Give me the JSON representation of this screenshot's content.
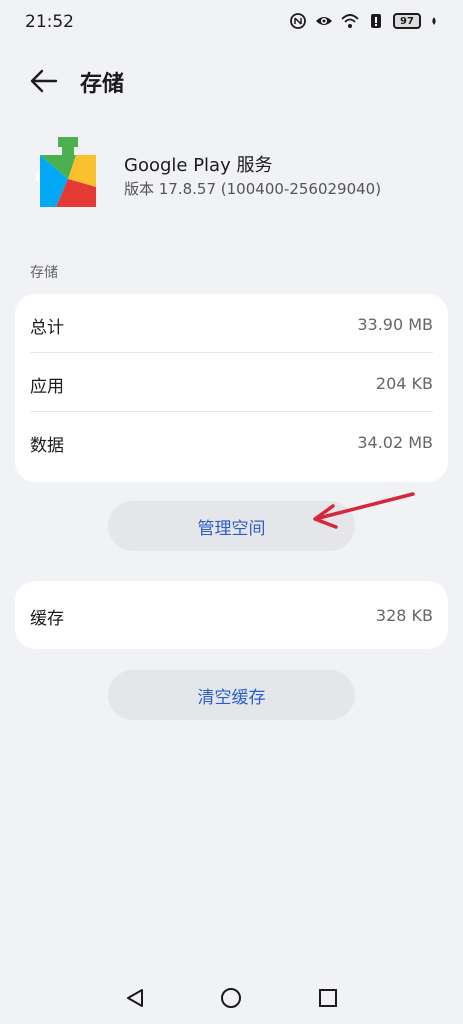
{
  "status_bar": {
    "time": "21:52",
    "battery": "97",
    "icons": [
      "nfc-icon",
      "eye-icon",
      "wifi-icon",
      "alert-icon",
      "battery-icon",
      "leaf-icon"
    ]
  },
  "header": {
    "title": "存储",
    "back_icon": "arrow-left-icon"
  },
  "app": {
    "name": "Google Play 服务",
    "version": "版本 17.8.57 (100400-256029040)"
  },
  "storage": {
    "section_label": "存储",
    "rows": [
      {
        "label": "总计",
        "value": "33.90 MB"
      },
      {
        "label": "应用",
        "value": "204 KB"
      },
      {
        "label": "数据",
        "value": "34.02 MB"
      }
    ],
    "manage_button": "管理空间"
  },
  "cache": {
    "label": "缓存",
    "value": "328 KB",
    "clear_button": "清空缓存"
  },
  "annotation": {
    "arrow_color": "#d8263b"
  },
  "nav": {
    "icons": [
      "back-triangle-icon",
      "home-circle-icon",
      "recents-square-icon"
    ]
  }
}
